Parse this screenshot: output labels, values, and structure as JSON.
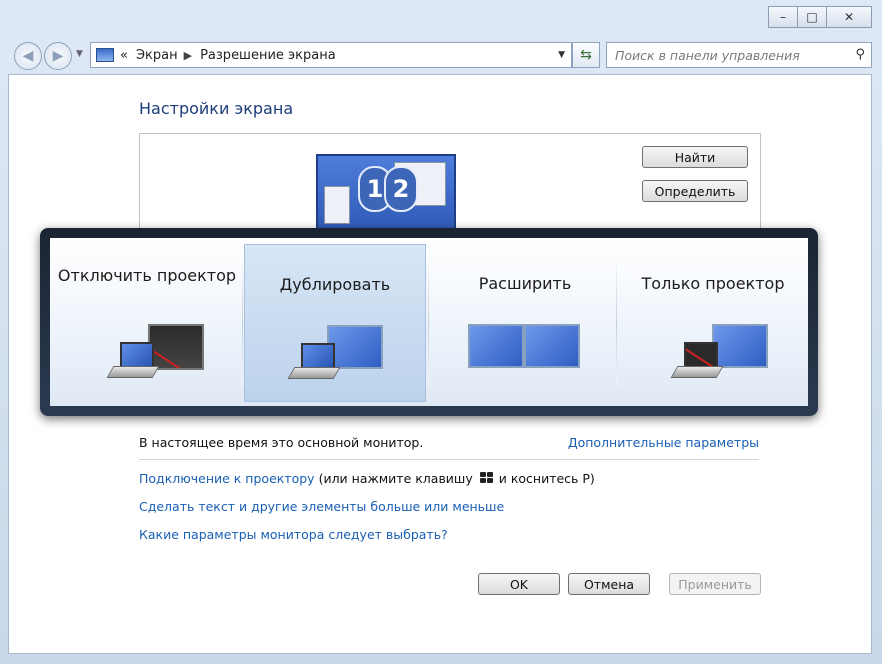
{
  "window": {
    "controls": {
      "minimize": "–",
      "maximize": "□",
      "close": "✕"
    }
  },
  "nav": {
    "back_icon": "arrow-left",
    "forward_icon": "arrow-right",
    "breadcrumb_prefix": "«",
    "breadcrumbs": [
      "Экран",
      "Разрешение экрана"
    ],
    "breadcrumb_sep": "▶",
    "search_placeholder": "Поиск в панели управления"
  },
  "page": {
    "title": "Настройки экрана",
    "find_button": "Найти",
    "identify_button": "Определить",
    "monitor_numbers": [
      "1",
      "2"
    ]
  },
  "projection": {
    "options": [
      {
        "label": "Отключить проектор",
        "mode": "computer-only",
        "selected": false
      },
      {
        "label": "Дублировать",
        "mode": "duplicate",
        "selected": true
      },
      {
        "label": "Расширить",
        "mode": "extend",
        "selected": false
      },
      {
        "label": "Только проектор",
        "mode": "projector-only",
        "selected": false
      }
    ]
  },
  "lower": {
    "main_monitor_text": "В настоящее время это основной монитор.",
    "advanced_link": "Дополнительные параметры",
    "projector_link": "Подключение к проектору",
    "projector_note_before": "(или нажмите клавишу",
    "projector_note_after": "и коснитесь P)",
    "text_size_link": "Сделать текст и другие элементы больше или меньше",
    "monitor_help_link": "Какие параметры монитора следует выбрать?"
  },
  "footer": {
    "ok": "OK",
    "cancel": "Отмена",
    "apply": "Применить"
  },
  "colors": {
    "link": "#1a5fb4",
    "title": "#1e3d7b",
    "selected_bg": "#bcd2ec"
  }
}
